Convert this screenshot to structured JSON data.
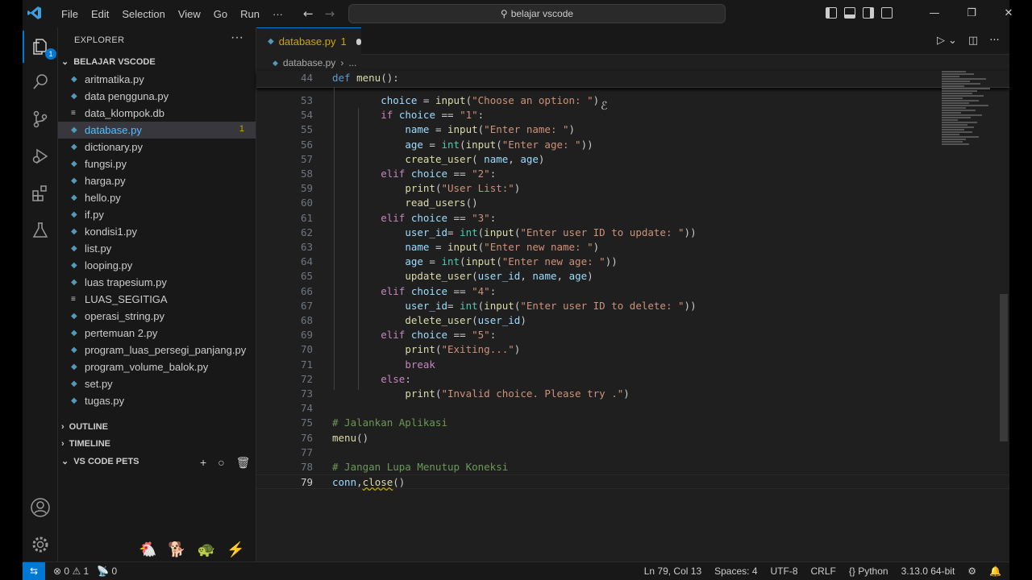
{
  "menu": [
    "File",
    "Edit",
    "Selection",
    "View",
    "Go",
    "Run",
    "···"
  ],
  "search": {
    "text": "belajar vscode"
  },
  "activity_badge": "1",
  "sidebar": {
    "title": "EXPLORER",
    "folder": "BELAJAR VSCODE",
    "files": [
      {
        "name": "aritmatika.py",
        "type": "py"
      },
      {
        "name": "data pengguna.py",
        "type": "py"
      },
      {
        "name": "data_klompok.db",
        "type": "db"
      },
      {
        "name": "database.py",
        "type": "py",
        "selected": true,
        "problems": "1"
      },
      {
        "name": "dictionary.py",
        "type": "py"
      },
      {
        "name": "fungsi.py",
        "type": "py"
      },
      {
        "name": "harga.py",
        "type": "py"
      },
      {
        "name": "hello.py",
        "type": "py"
      },
      {
        "name": "if.py",
        "type": "py"
      },
      {
        "name": "kondisi1.py",
        "type": "py"
      },
      {
        "name": "list.py",
        "type": "py"
      },
      {
        "name": "looping.py",
        "type": "py"
      },
      {
        "name": "luas trapesium.py",
        "type": "py"
      },
      {
        "name": "LUAS_SEGITIGA",
        "type": "db"
      },
      {
        "name": "operasi_string.py",
        "type": "py"
      },
      {
        "name": "pertemuan 2.py",
        "type": "py"
      },
      {
        "name": "program_luas_persegi_panjang.py",
        "type": "py"
      },
      {
        "name": "program_volume_balok.py",
        "type": "py"
      },
      {
        "name": "set.py",
        "type": "py"
      },
      {
        "name": "tugas.py",
        "type": "py"
      }
    ],
    "outline": "OUTLINE",
    "timeline": "TIMELINE",
    "pets": "VS CODE PETS"
  },
  "tab": {
    "name": "database.py",
    "count": "1"
  },
  "breadcrumb": {
    "file": "database.py",
    "rest": "..."
  },
  "sticky": {
    "num": "44",
    "code": "def menu():"
  },
  "code_lines": [
    {
      "n": "53",
      "t": "        choice = input(\"Choose an option: \")"
    },
    {
      "n": "54",
      "t": "        if choice == \"1\":"
    },
    {
      "n": "55",
      "t": "            name = input(\"Enter name: \")"
    },
    {
      "n": "56",
      "t": "            age = int(input(\"Enter age: \"))"
    },
    {
      "n": "57",
      "t": "            create_user( name, age)"
    },
    {
      "n": "58",
      "t": "        elif choice == \"2\":"
    },
    {
      "n": "59",
      "t": "            print(\"User List:\")"
    },
    {
      "n": "60",
      "t": "            read_users()"
    },
    {
      "n": "61",
      "t": "        elif choice == \"3\":"
    },
    {
      "n": "62",
      "t": "            user_id= int(input(\"Enter user ID to update: \"))"
    },
    {
      "n": "63",
      "t": "            name = input(\"Enter new name: \")"
    },
    {
      "n": "64",
      "t": "            age = int(input(\"Enter new age: \"))"
    },
    {
      "n": "65",
      "t": "            update_user(user_id, name, age)"
    },
    {
      "n": "66",
      "t": "        elif choice == \"4\":"
    },
    {
      "n": "67",
      "t": "            user_id= int(input(\"Enter user ID to delete: \"))"
    },
    {
      "n": "68",
      "t": "            delete_user(user_id)"
    },
    {
      "n": "69",
      "t": "        elif choice == \"5\":"
    },
    {
      "n": "70",
      "t": "            print(\"Exiting...\")"
    },
    {
      "n": "71",
      "t": "            break"
    },
    {
      "n": "72",
      "t": "        else:"
    },
    {
      "n": "73",
      "t": "            print(\"Invalid choice. Please try .\")"
    },
    {
      "n": "74",
      "t": ""
    },
    {
      "n": "75",
      "t": "# Jalankan Aplikasi"
    },
    {
      "n": "76",
      "t": "menu()"
    },
    {
      "n": "77",
      "t": ""
    },
    {
      "n": "78",
      "t": "# Jangan Lupa Menutup Koneksi"
    },
    {
      "n": "79",
      "t": "conn,close()"
    }
  ],
  "status": {
    "errors": "0",
    "warnings": "1",
    "ports": "0",
    "position": "Ln 79, Col 13",
    "spaces": "Spaces: 4",
    "encoding": "UTF-8",
    "eol": "CRLF",
    "language": "Python",
    "interpreter": "3.13.0 64-bit"
  },
  "colors": {
    "accent": "#0078d4",
    "warning": "#cca700",
    "selected_file": "#4fc1ff"
  }
}
